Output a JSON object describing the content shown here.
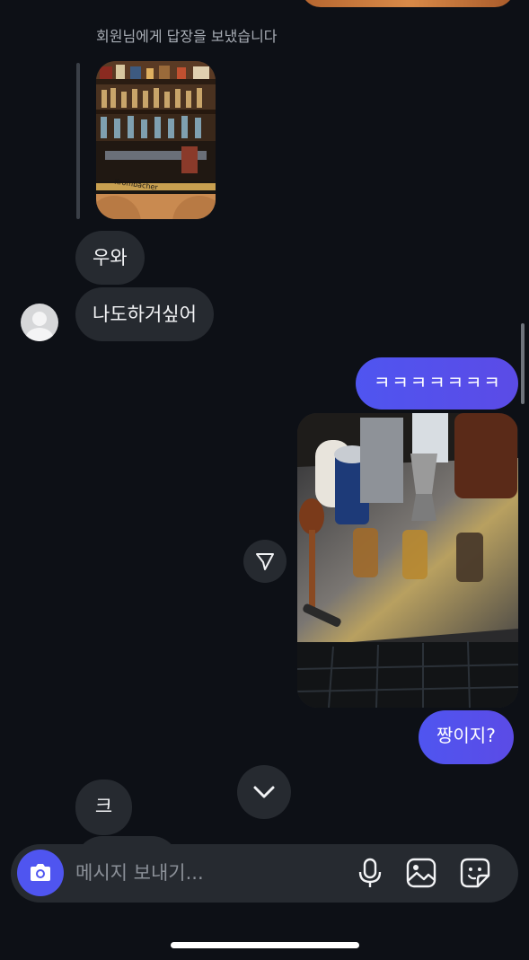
{
  "reply": {
    "caption": "회원님에게 답장을 보냈습니다"
  },
  "messages": {
    "incoming_1": "우와",
    "incoming_2": "나도하거싶어",
    "outgoing_1": "ㅋㅋㅋㅋㅋㅋㅋ",
    "outgoing_2": "짱이지?",
    "incoming_3": "크"
  },
  "composer": {
    "placeholder": "메시지 보내기..."
  },
  "icons": {
    "share": "paper-plane-icon",
    "scroll_down": "chevron-down-icon",
    "camera": "camera-icon",
    "mic": "microphone-icon",
    "gallery": "image-icon",
    "sticker": "sticker-icon"
  },
  "colors": {
    "background": "#0d1016",
    "incoming_bubble": "#262a30",
    "outgoing_bubble": "#5250ec",
    "accent": "#4f55f0"
  }
}
